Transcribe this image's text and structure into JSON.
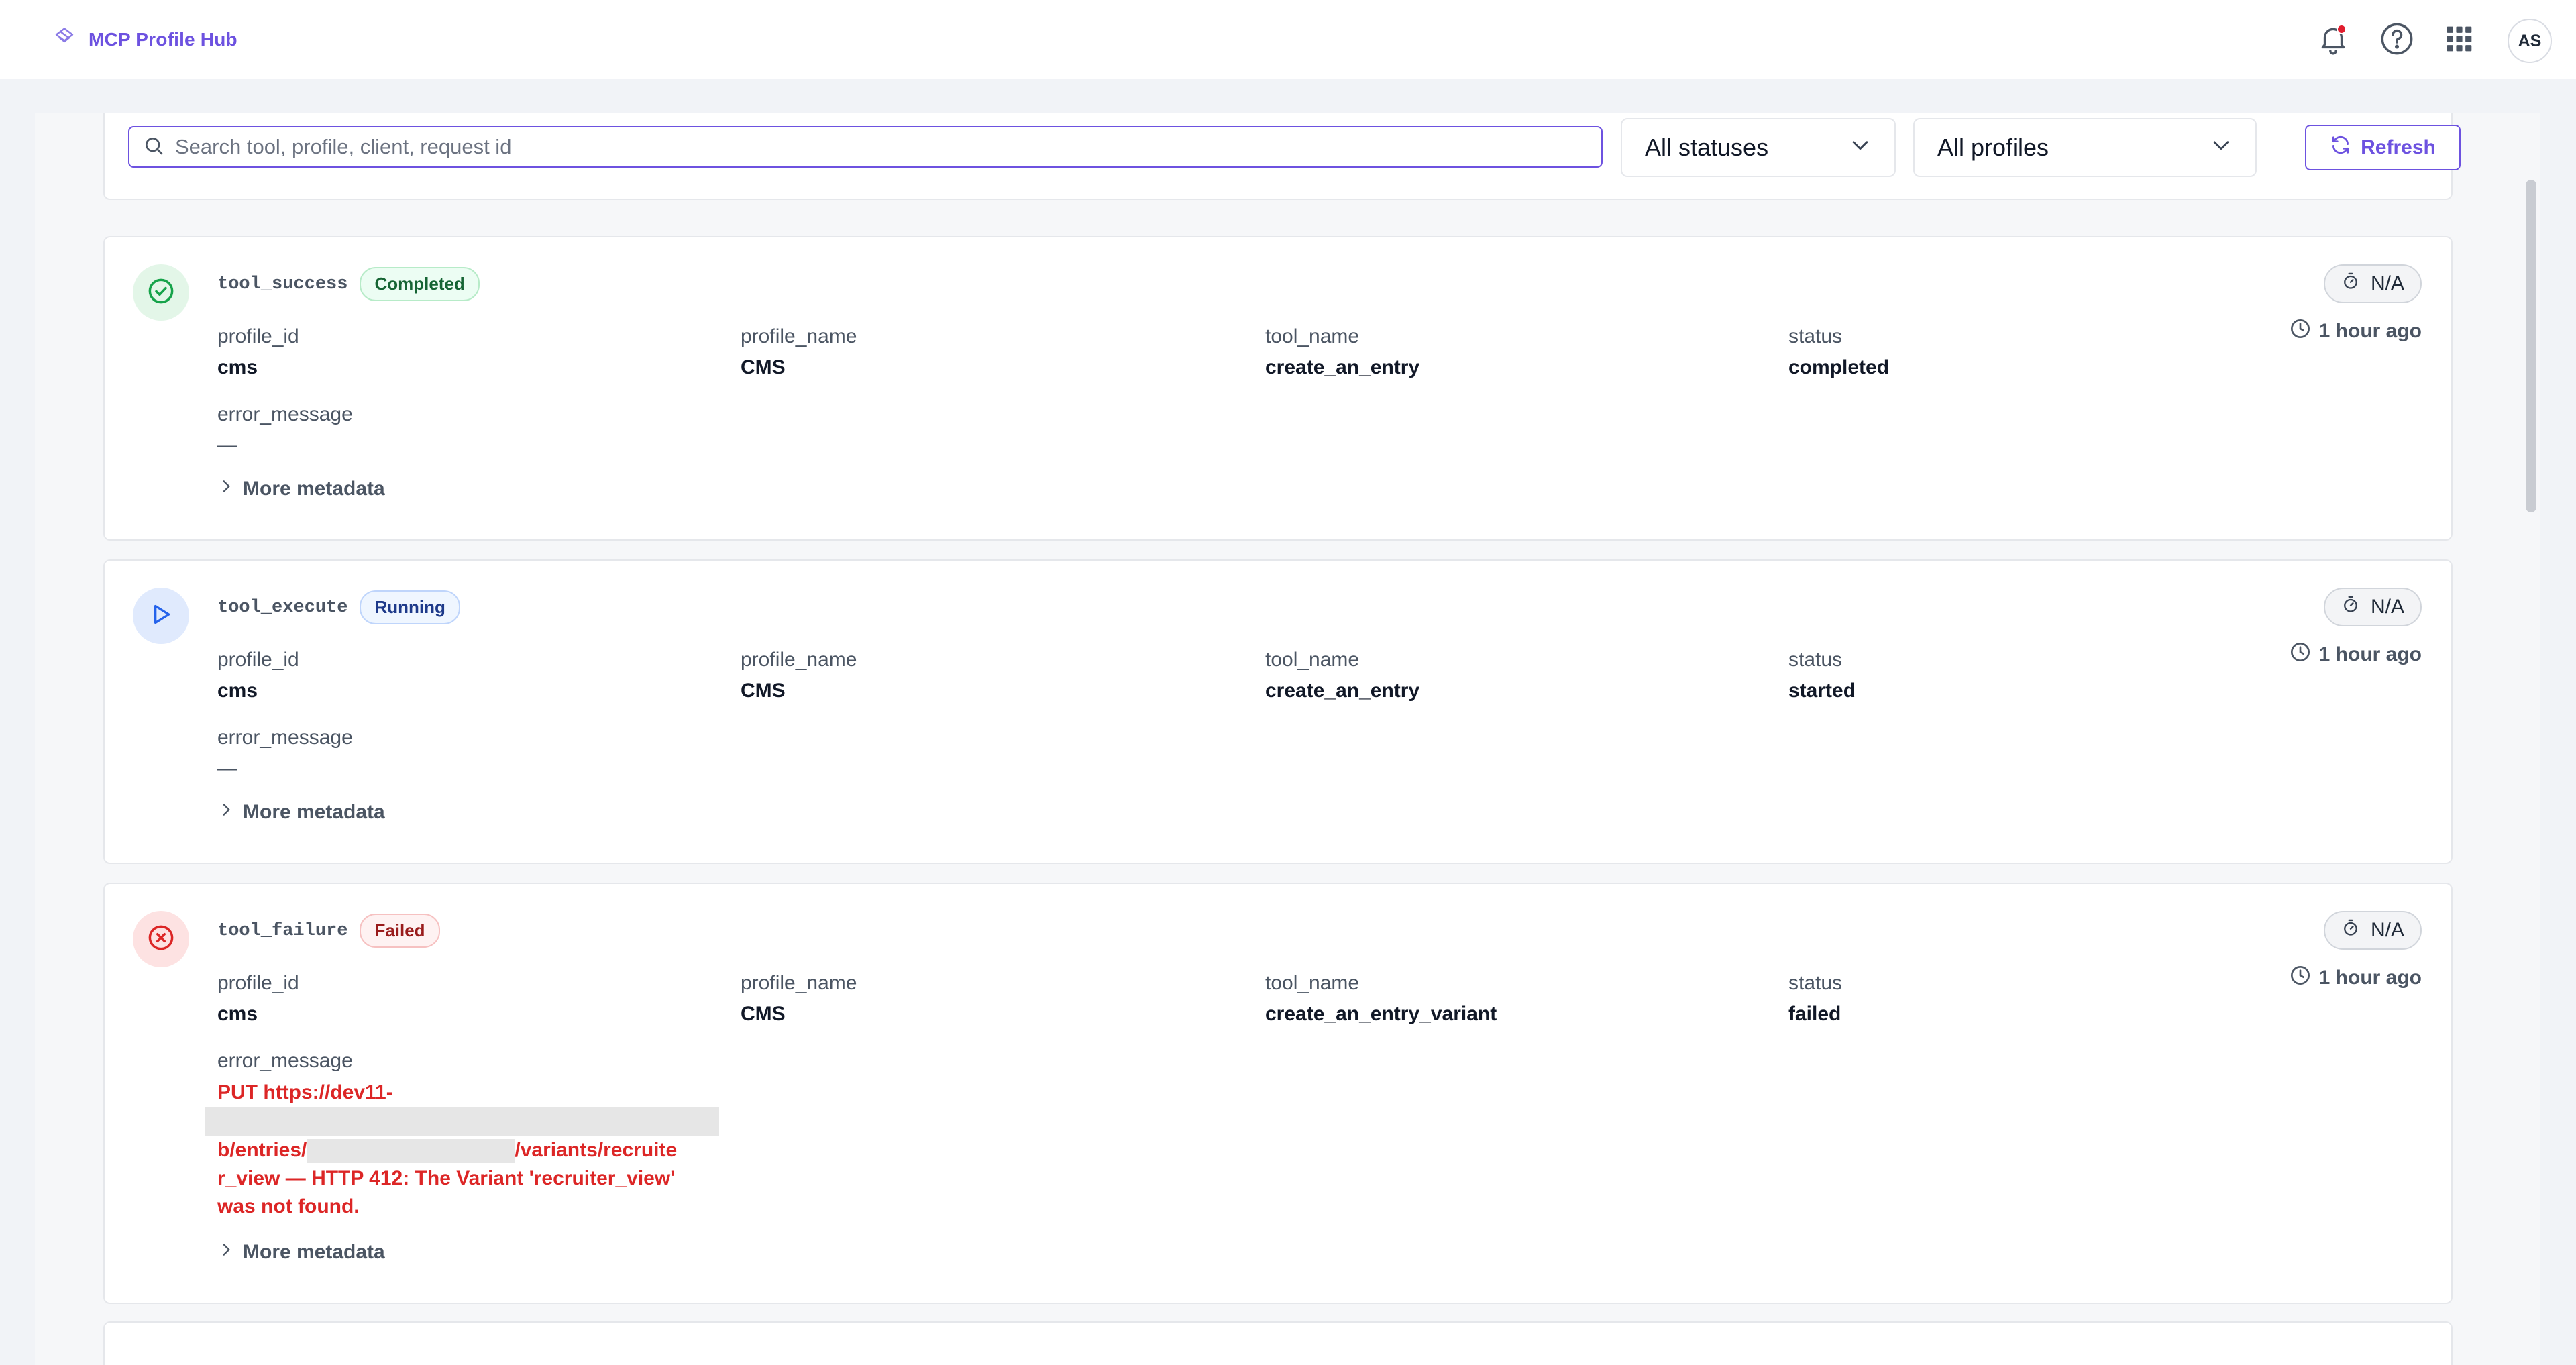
{
  "app": {
    "title": "MCP Profile Hub",
    "user_initials": "AS"
  },
  "colors": {
    "accent": "#6d52e0",
    "success": "#16a34a",
    "running": "#2563eb",
    "failure": "#dc2626"
  },
  "icons": {
    "brand": "layers-icon",
    "notifications": "bell-icon",
    "help": "help-circle-icon",
    "apps": "grid-icon"
  },
  "filters": {
    "search_placeholder": "Search tool, profile, client, request id",
    "status_selected": "All statuses",
    "profile_selected": "All profiles",
    "refresh_label": "Refresh"
  },
  "labels": {
    "profile_id": "profile_id",
    "profile_name": "profile_name",
    "tool_name": "tool_name",
    "status": "status",
    "error_message": "error_message",
    "more_metadata": "More metadata",
    "empty_value": "—"
  },
  "logs": [
    {
      "event": "tool_success",
      "badge": "Completed",
      "profile_id": "cms",
      "profile_name": "CMS",
      "tool_name": "create_an_entry",
      "status": "completed",
      "error_message": "—",
      "duration": "N/A",
      "time_ago": "1 hour ago"
    },
    {
      "event": "tool_execute",
      "badge": "Running",
      "profile_id": "cms",
      "profile_name": "CMS",
      "tool_name": "create_an_entry",
      "status": "started",
      "error_message": "—",
      "duration": "N/A",
      "time_ago": "1 hour ago"
    },
    {
      "event": "tool_failure",
      "badge": "Failed",
      "profile_id": "cms",
      "profile_name": "CMS",
      "tool_name": "create_an_entry_variant",
      "status": "failed",
      "error_parts": {
        "line1": "PUT https://dev11-",
        "line2": "b/entries/",
        "line2_tail": "/variants/recruite",
        "line3": "r_view — HTTP 412: The Variant 'recruiter_view'",
        "line4": "was not found."
      },
      "duration": "N/A",
      "time_ago": "1 hour ago"
    }
  ]
}
